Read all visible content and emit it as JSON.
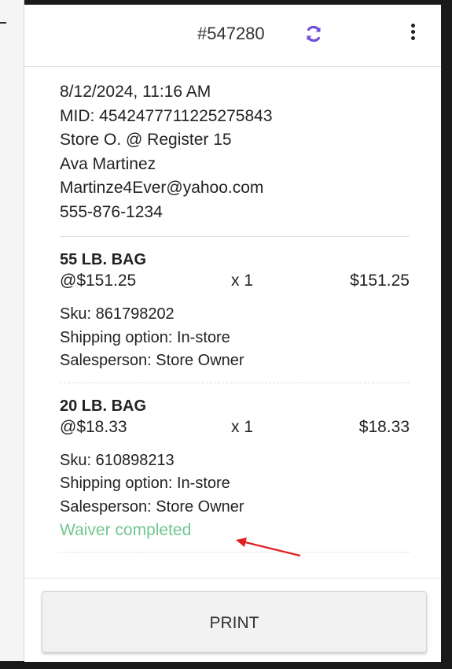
{
  "header": {
    "order_number": "#547280",
    "refresh_icon": "refresh-icon",
    "menu_icon": "more-vertical-icon",
    "accent_color": "#6f4fd8"
  },
  "customer": {
    "datetime": "8/12/2024, 11:16 AM",
    "mid": "MID: 4542477711225275843",
    "store": "Store O. @ Register 15",
    "name": "Ava Martinez",
    "email": "Martinze4Ever@yahoo.com",
    "phone": "555-876-1234"
  },
  "items": [
    {
      "name": "55 LB. BAG",
      "unit_price": "@$151.25",
      "qty": "x 1",
      "total": "$151.25",
      "sku": "Sku: 861798202",
      "shipping": "Shipping option: In-store",
      "salesperson": "Salesperson: Store Owner"
    },
    {
      "name": "20 LB. BAG",
      "unit_price": "@$18.33",
      "qty": "x 1",
      "total": "$18.33",
      "sku": "Sku: 610898213",
      "shipping": "Shipping option: In-store",
      "salesperson": "Salesperson: Store Owner",
      "waiver": "Waiver completed",
      "waiver_color": "#73c68f"
    }
  ],
  "footer": {
    "print_label": "PRINT"
  },
  "annotation": {
    "arrow_color": "#e02020"
  }
}
